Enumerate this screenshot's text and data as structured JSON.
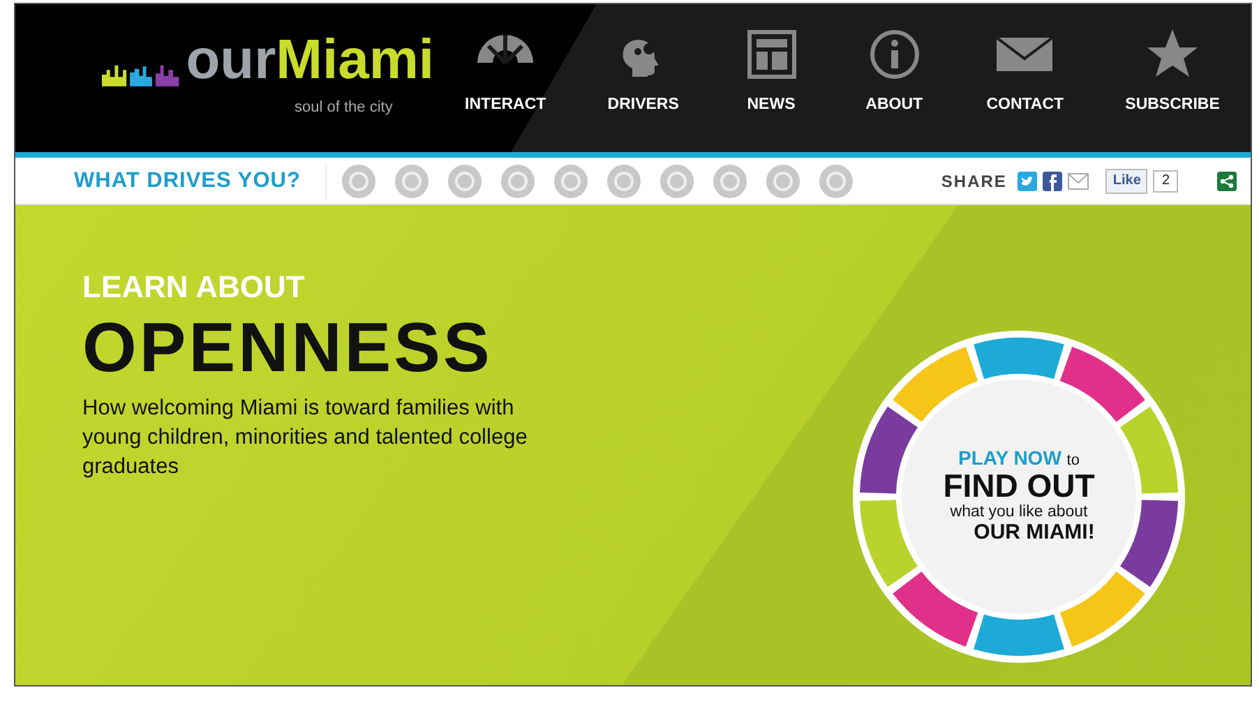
{
  "logo": {
    "word_1": "our",
    "word_2": "Miami",
    "tagline": "soul of the city"
  },
  "nav": [
    {
      "label": "INTERACT"
    },
    {
      "label": "DRIVERS"
    },
    {
      "label": "NEWS"
    },
    {
      "label": "ABOUT"
    },
    {
      "label": "CONTACT"
    },
    {
      "label": "SUBSCRIBE"
    }
  ],
  "drivers_bar": {
    "title": "WHAT DRIVES YOU?",
    "share_label": "SHARE",
    "like_label": "Like",
    "like_count": "2"
  },
  "hero": {
    "kicker": "LEARN ABOUT",
    "heading": "OPENNESS",
    "description": "How welcoming Miami is toward families with young children, minorities and talented college graduates"
  },
  "wheel": {
    "line_1_highlight": "PLAY NOW",
    "line_1_rest": "to",
    "line_2": "FIND OUT",
    "line_3": "what you like about",
    "line_4": "OUR MIAMI!",
    "segments": [
      {
        "color": "#1eaad6"
      },
      {
        "color": "#e0308a"
      },
      {
        "color": "#b9d22c"
      },
      {
        "color": "#7a3b9e"
      },
      {
        "color": "#f5c518"
      },
      {
        "color": "#1eaad6"
      },
      {
        "color": "#e0308a"
      },
      {
        "color": "#b9d22c"
      },
      {
        "color": "#7a3b9e"
      },
      {
        "color": "#f5c518"
      }
    ]
  }
}
